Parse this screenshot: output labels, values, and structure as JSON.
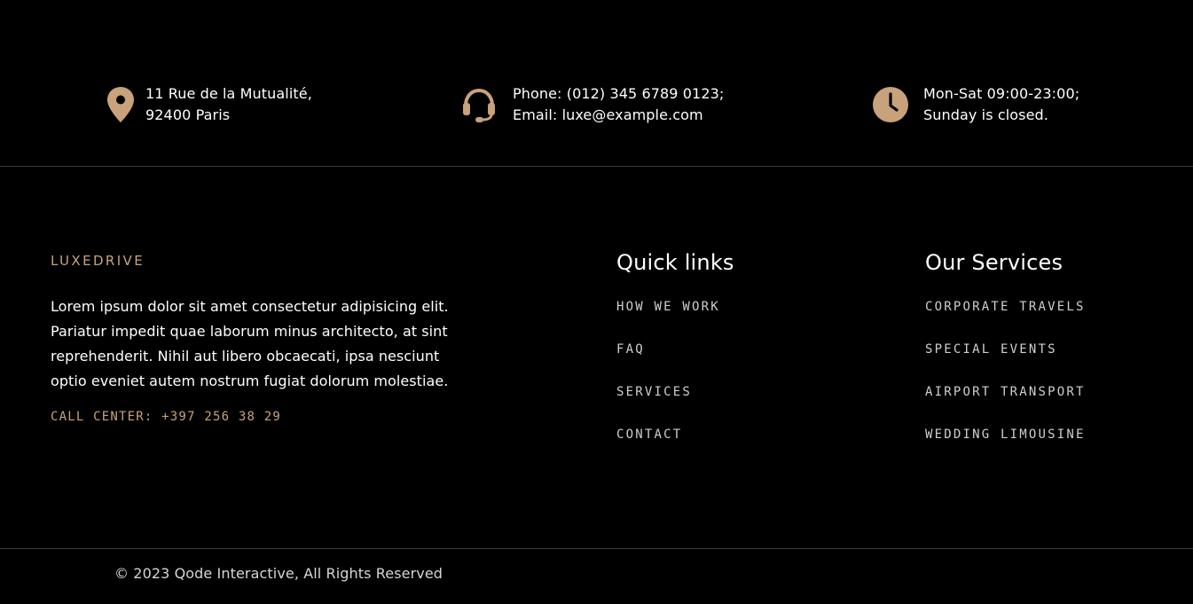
{
  "colors": {
    "background": "#000000",
    "accent": "#c7a27a",
    "text": "#ffffff",
    "muted": "#cfcfcf",
    "divider": "#3a3a3a"
  },
  "contact": {
    "address": {
      "icon": "map-pin-icon",
      "line1": "11 Rue de la Mutualité,",
      "line2": "92400 Paris"
    },
    "phone": {
      "icon": "headset-icon",
      "line1": "Phone: (012) 345 6789 0123;",
      "line2": "Email: luxe@example.com"
    },
    "hours": {
      "icon": "clock-icon",
      "line1": "Mon-Sat 09:00-23:00;",
      "line2": "Sunday is closed."
    }
  },
  "brand": {
    "name": "LUXEDRIVE",
    "description": "Lorem ipsum dolor sit amet consectetur adipisicing elit. Pariatur impedit quae laborum minus architecto, at sint reprehenderit. Nihil aut libero obcaecati, ipsa nesciunt optio eveniet autem nostrum fugiat dolorum molestiae.",
    "call_center": "CALL CENTER: +397 256 38 29"
  },
  "quick_links": {
    "title": "Quick links",
    "items": [
      {
        "label": "HOW WE WORK"
      },
      {
        "label": "FAQ"
      },
      {
        "label": "SERVICES"
      },
      {
        "label": "CONTACT"
      }
    ]
  },
  "services": {
    "title": "Our Services",
    "items": [
      {
        "label": "CORPORATE TRAVELS"
      },
      {
        "label": "SPECIAL EVENTS"
      },
      {
        "label": "AIRPORT TRANSPORT"
      },
      {
        "label": "WEDDING LIMOUSINE"
      }
    ]
  },
  "footer": {
    "copyright": "© 2023 Qode Interactive, All Rights Reserved"
  }
}
